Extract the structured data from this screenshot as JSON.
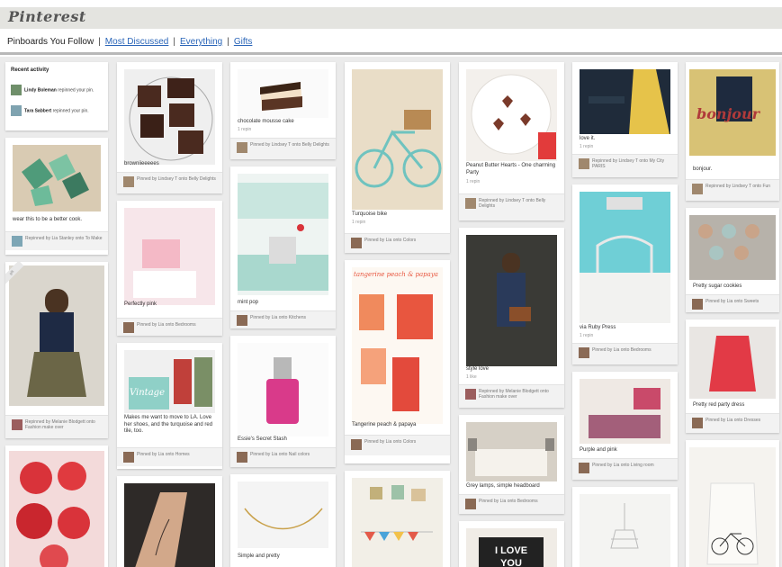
{
  "app": {
    "logo": "Pinterest"
  },
  "nav": {
    "current": "Pinboards You Follow",
    "sep": "|",
    "links": [
      "Most Discussed",
      "Everything",
      "Gifts"
    ]
  },
  "activity": {
    "title": "Recent activity",
    "items": [
      {
        "user": "Lindy Boleman",
        "action": "repinned your pin."
      },
      {
        "user": "Tara Sabbert",
        "action": "repinned your pin."
      }
    ]
  },
  "pins": {
    "p1": {
      "desc": "wear this to be a better cook.",
      "via": "Repinned by Lia Stanley onto To Make"
    },
    "p2": {
      "badge": "gift",
      "via": "Repinned by Melanie Blodgett onto Fashion make over"
    },
    "p3": {
      "desc": "browniieeeees",
      "via": "Pinned by Lindsey T onto Belly Delights"
    },
    "p4": {
      "desc": "Perfectly pink",
      "via": "Pinned by Lia onto Bedrooms"
    },
    "p5": {
      "desc": "Makes me want to move to LA. Love her shoes, and the turquoise and red tile, too.",
      "via": "Pinned by Lia onto Homes"
    },
    "p6": {
      "desc": "chocolate mousse cake",
      "repins": "1 repin",
      "via": "Pinned by Lindsey T onto Belly Delights"
    },
    "p7": {
      "desc": "mint pop",
      "via": "Pinned by Lia onto Kitchens"
    },
    "p8": {
      "desc": "Essie's Secret Stash",
      "via": "Pinned by Lia onto Nail colors"
    },
    "p9": {
      "desc": "Simple and pretty"
    },
    "p10": {
      "desc": "Turquoise bike",
      "repins": "1 repin",
      "via": "Pinned by Lia onto Colors"
    },
    "p11": {
      "desc": "Tangerine peach & papaya",
      "via": "Pinned by Lia onto Colors",
      "overlay": [
        "tangerine",
        "peach",
        "&",
        "papaya"
      ]
    },
    "p12": {
      "desc": "Peanut Butter Hearts - One charming Party",
      "repins": "1 repin",
      "via": "Repinned by Lindsey T onto Belly Delights"
    },
    "p13": {
      "desc": "style love",
      "repins": "1 like",
      "via": "Repinned by Melanie Blodgett onto Fashion make over"
    },
    "p14": {
      "desc": "Grey lamps, simple headboard",
      "via": "Pinned by Lia onto Bedrooms"
    },
    "p15": {
      "sign": [
        "I LOVE",
        "YOU"
      ]
    },
    "p16": {
      "desc": "love it.",
      "repins": "1 repin",
      "via": "Repinned by Lindsey T onto My City PARIS"
    },
    "p17": {
      "desc": "via Ruby Press",
      "repins": "1 repin",
      "via": "Pinned by Lia onto Bedrooms"
    },
    "p18": {
      "desc": "Purple and pink",
      "via": "Pinned by Lia onto Living room"
    },
    "p19": {
      "desc": "bonjour.",
      "via": "Repinned by Lindsey T onto Fun",
      "overlay": "bonjour"
    },
    "p20": {
      "desc": "Pretty sugar cookies",
      "via": "Pinned by Lia onto Sweets"
    },
    "p21": {
      "desc": "Pretty red party dress",
      "via": "Pinned by Lia onto Dresses"
    }
  },
  "colors": {
    "link": "#2a65b8",
    "board_bg": "#ebebeb",
    "logo_band": "#e4e4e0"
  }
}
